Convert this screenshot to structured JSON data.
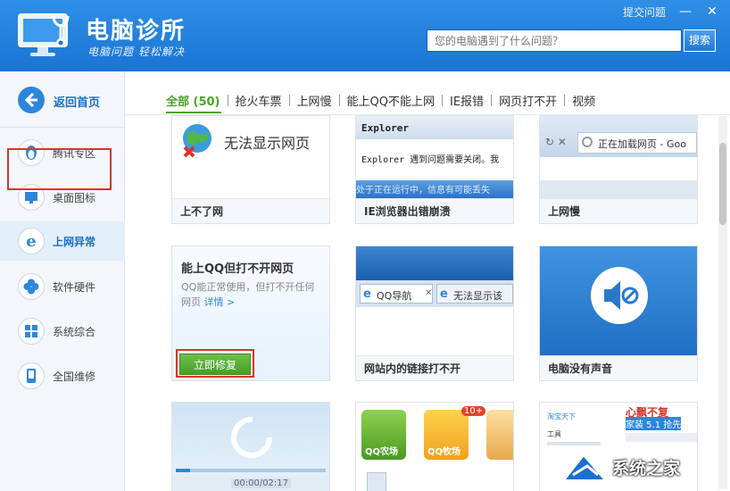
{
  "header": {
    "title": "电脑诊所",
    "slogan": "电脑问题 轻松解决",
    "report_link": "提交问题",
    "minimize_icon": "minimize-icon",
    "close_icon": "close-icon",
    "search_placeholder": "您的电脑遇到了什么问题？",
    "search_button": "搜索"
  },
  "sidebar": {
    "back_label": "返回首页",
    "items": [
      {
        "label": "腾讯专区",
        "icon": "penguin-icon"
      },
      {
        "label": "桌面图标",
        "icon": "monitor-icon"
      },
      {
        "label": "上网异常",
        "icon": "ie-icon",
        "active": true
      },
      {
        "label": "软件硬件",
        "icon": "clover-icon"
      },
      {
        "label": "系统综合",
        "icon": "windows-icon"
      },
      {
        "label": "全国维修",
        "icon": "phone-icon"
      }
    ]
  },
  "tabs": [
    {
      "label": "全部 (50)",
      "active": true
    },
    {
      "label": "抢火车票"
    },
    {
      "label": "上网慢"
    },
    {
      "label": "能上QQ不能上网"
    },
    {
      "label": "IE报错"
    },
    {
      "label": "网页打不开"
    },
    {
      "label": "视频"
    }
  ],
  "cards": {
    "c1": {
      "thumb_text": "无法显示网页",
      "caption": "上不了网"
    },
    "c2": {
      "thumb_title": "Explorer",
      "thumb_text": "Explorer 遇到问题需要关闭。我",
      "thumb_text2": "处于正在运行中，信息有可能丢失",
      "caption": "IE浏览器出错崩溃"
    },
    "c3": {
      "thumb_text": "正在加载网页 - Goo",
      "caption": "上网慢"
    },
    "featured": {
      "title": "能上QQ但打不开网页",
      "desc": "QQ能正常使用，但打不开任何网页",
      "link": "详情 >",
      "button": "立即修复"
    },
    "c5": {
      "tab1": "QQ导航",
      "tab2": "无法显示该",
      "caption": "网站内的链接打不开"
    },
    "c6": {
      "caption": "电脑没有声音"
    },
    "c7": {
      "time": "00:00/02:17"
    },
    "c8": {
      "badge": "10+",
      "game1": "QQ农场",
      "game2": "QQ牧场"
    },
    "c9": {
      "line1": "心飘不复",
      "line2": "家装 5.1 抢先",
      "line3": "淘宝天下",
      "line4": "工具"
    }
  },
  "watermark": {
    "text": "系统之家"
  },
  "colors": {
    "brand": "#1a74d4",
    "accent_green": "#4aa32a",
    "alert_red": "#d9342b"
  }
}
